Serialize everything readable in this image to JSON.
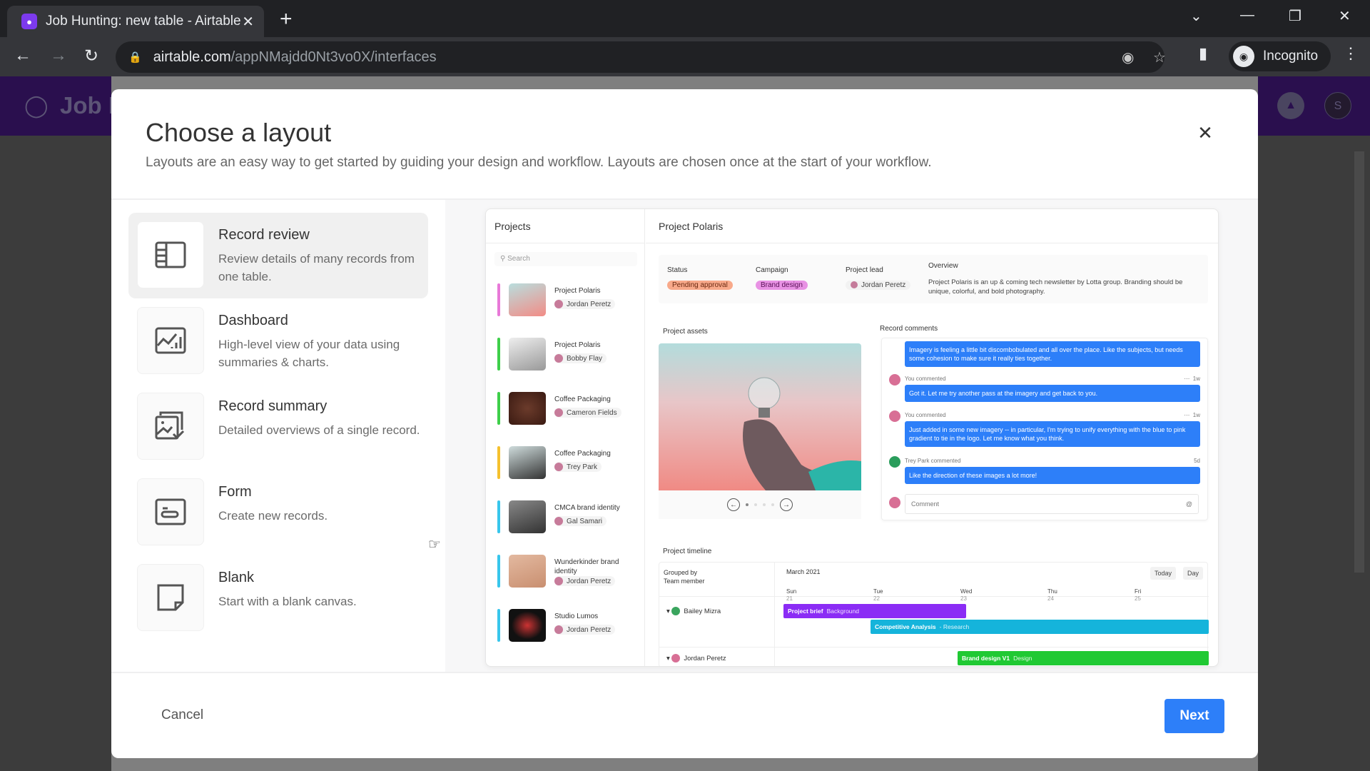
{
  "browser": {
    "tab_title": "Job Hunting: new table - Airtable",
    "url_host": "airtable.com",
    "url_path": "/appNMajdd0Nt3vo0X/interfaces",
    "profile_label": "Incognito"
  },
  "app": {
    "name": "Job H",
    "user_initial": "S"
  },
  "dialog": {
    "title": "Choose a layout",
    "subtitle": "Layouts are an easy way to get started by guiding your design and workflow. Layouts are chosen once at the start of your workflow.",
    "cancel_label": "Cancel",
    "next_label": "Next",
    "layouts": [
      {
        "title": "Record review",
        "description": "Review details of many records from one table.",
        "icon": "record-review-icon",
        "selected": true
      },
      {
        "title": "Dashboard",
        "description": "High-level view of your data using summaries & charts.",
        "icon": "dashboard-chart-icon",
        "selected": false
      },
      {
        "title": "Record summary",
        "description": "Detailed overviews of a single record.",
        "icon": "record-summary-icon",
        "selected": false
      },
      {
        "title": "Form",
        "description": "Create new records.",
        "icon": "form-icon",
        "selected": false
      },
      {
        "title": "Blank",
        "description": "Start with a blank canvas.",
        "icon": "blank-canvas-icon",
        "selected": false
      }
    ]
  },
  "preview": {
    "list_header": "Projects",
    "search_placeholder": "Search",
    "projects": [
      {
        "name": "Project Polaris",
        "person": "Jordan Peretz",
        "color": "#e879d8"
      },
      {
        "name": "Project Polaris",
        "person": "Bobby Flay",
        "color": "#3ecf4a"
      },
      {
        "name": "Coffee Packaging",
        "person": "Cameron Fields",
        "color": "#3ecf4a"
      },
      {
        "name": "Coffee Packaging",
        "person": "Trey Park",
        "color": "#f5c12e"
      },
      {
        "name": "CMCA brand identity",
        "person": "Gal Samari",
        "color": "#38c6ec"
      },
      {
        "name": "Wunderkinder brand identity",
        "person": "Jordan Peretz",
        "color": "#38c6ec"
      },
      {
        "name": "Studio Lumos",
        "person": "Jordan Peretz",
        "color": "#38c6ec"
      }
    ],
    "detail_title": "Project Polaris",
    "fields": {
      "status_label": "Status",
      "status_value": "Pending approval",
      "campaign_label": "Campaign",
      "campaign_value": "Brand design",
      "lead_label": "Project lead",
      "lead_value": "Jordan Peretz",
      "overview_label": "Overview",
      "overview_value": "Project Polaris is an up & coming tech newsletter by Lotta group. Branding should be unique, colorful, and bold photography."
    },
    "assets_label": "Project assets",
    "comments_label": "Record comments",
    "comments": [
      {
        "author": "",
        "time": "",
        "text": "Imagery is feeling a little bit discombobulated and all over the place. Like the subjects, but needs some cohesion to make sure it really ties together."
      },
      {
        "author": "You commented",
        "time": "1w",
        "text": "Got it. Let me try another pass at the imagery and get back to you."
      },
      {
        "author": "You commented",
        "time": "1w",
        "text": "Just added in some new imagery -- in particular, I'm trying to unify everything with the blue to pink gradient to tie in the logo. Let me know what you think."
      },
      {
        "author": "Trey Park commented",
        "time": "5d",
        "text": "Like the direction of these images a lot more!"
      }
    ],
    "comment_placeholder": "Comment",
    "timeline": {
      "label": "Project timeline",
      "grouped_by": "Grouped by",
      "group_field": "Team member",
      "month": "March 2021",
      "today_label": "Today",
      "day_label": "Day",
      "days": [
        {
          "name": "Sun",
          "num": "21"
        },
        {
          "name": "Tue",
          "num": "22"
        },
        {
          "name": "Wed",
          "num": "23"
        },
        {
          "name": "Thu",
          "num": "24"
        },
        {
          "name": "Fri",
          "num": "25"
        }
      ],
      "people": [
        "Bailey Mizra",
        "Jordan Peretz"
      ],
      "tasks": [
        {
          "title": "Project brief",
          "category": "Background",
          "color": "#8b2cf5"
        },
        {
          "title": "Competitive Analysis",
          "category": "- Research",
          "color": "#15b4db"
        },
        {
          "title": "Brand design V1",
          "category": "Design",
          "color": "#20c933"
        }
      ]
    }
  }
}
